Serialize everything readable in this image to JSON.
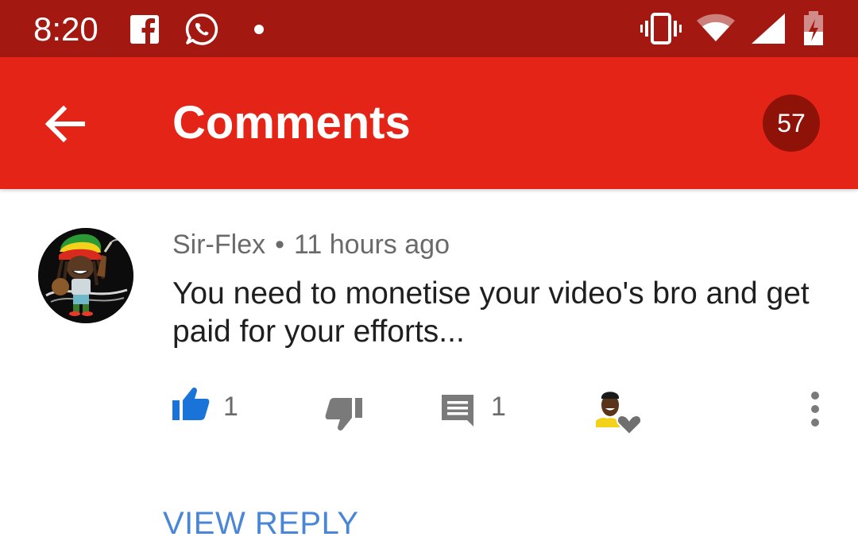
{
  "status_bar": {
    "time": "8:20",
    "icons": [
      "facebook-icon",
      "whatsapp-icon",
      "notification-dot-icon",
      "vibrate-icon",
      "wifi-icon",
      "cellular-signal-icon",
      "battery-charging-icon"
    ]
  },
  "app_bar": {
    "title": "Comments",
    "comment_count": "57",
    "back_icon": "arrow-back-icon"
  },
  "comment": {
    "author": "Sir-Flex",
    "separator": "•",
    "time_ago": "11 hours ago",
    "text": "You need to monetise your video's bro and get paid for your efforts...",
    "likes": "1",
    "replies": "1",
    "icons": [
      "thumb-up-icon",
      "thumb-down-icon",
      "reply-comment-icon",
      "creator-heart-icon",
      "more-vert-icon"
    ]
  },
  "view_reply_label": "VIEW REPLY",
  "colors": {
    "status_bar": "#a31912",
    "app_bar": "#e52418",
    "badge": "#8f1209",
    "like_active": "#1a73d9",
    "link": "#4a86d8"
  }
}
